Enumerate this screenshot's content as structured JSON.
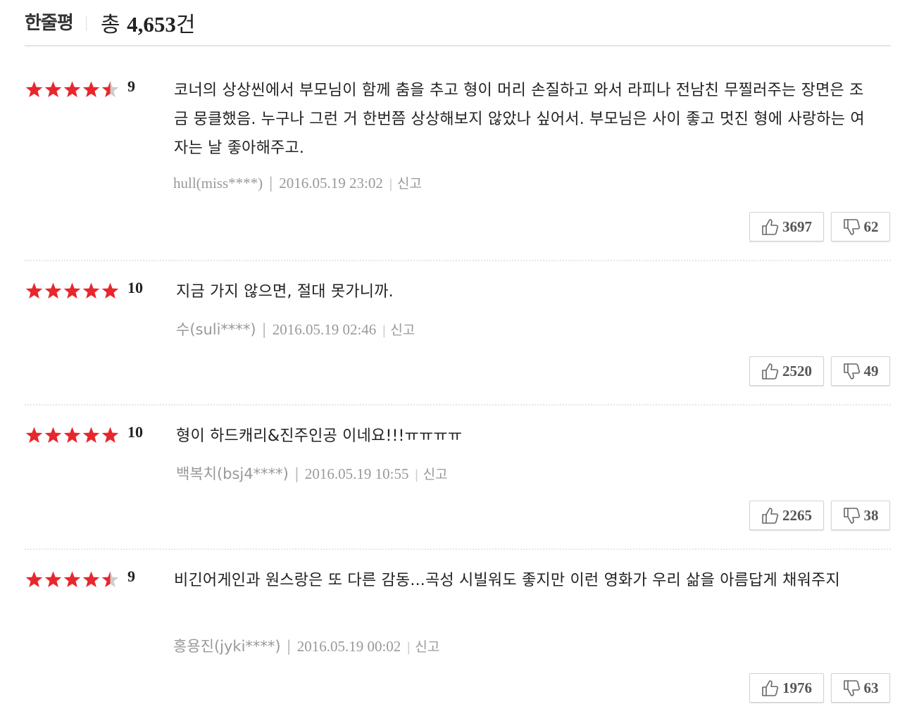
{
  "header": {
    "title": "한줄평",
    "total_prefix": "총",
    "total_count": "4,653",
    "total_suffix": "건"
  },
  "reviews": [
    {
      "rating": 4.5,
      "score": "9",
      "text": "코너의 상상씬에서 부모님이 함께 춤을 추고 형이 머리 손질하고 와서 라피나 전남친 무찔러주는 장면은 조금 뭉클했음. 누구나 그런 거 한번쯤 상상해보지 않았나 싶어서. 부모님은 사이 좋고 멋진 형에 사랑하는 여자는 날 좋아해주고.",
      "author": "hull(miss****)",
      "date": "2016.05.19 23:02",
      "report": "신고",
      "likes": "3697",
      "dislikes": "62"
    },
    {
      "rating": 5,
      "score": "10",
      "text": "지금 가지 않으면, 절대 못가니까.",
      "author": "수(suli****)",
      "date": "2016.05.19 02:46",
      "report": "신고",
      "likes": "2520",
      "dislikes": "49"
    },
    {
      "rating": 5,
      "score": "10",
      "text": "형이 하드캐리&진주인공 이네요!!!ㅠㅠㅠㅠ",
      "author": "백복치(bsj4****)",
      "date": "2016.05.19 10:55",
      "report": "신고",
      "likes": "2265",
      "dislikes": "38"
    },
    {
      "rating": 4.5,
      "score": "9",
      "text": "비긴어게인과 원스랑은 또 다른 감동...곡성 시빌워도 좋지만 이런 영화가 우리 삶을 아름답게 채워주지",
      "author": "홍용진(jyki****)",
      "date": "2016.05.19 00:02",
      "report": "신고",
      "likes": "1976",
      "dislikes": "63"
    }
  ],
  "colors": {
    "star_filled": "#e8262d",
    "star_empty": "#cccccc",
    "text_muted": "#999999"
  }
}
